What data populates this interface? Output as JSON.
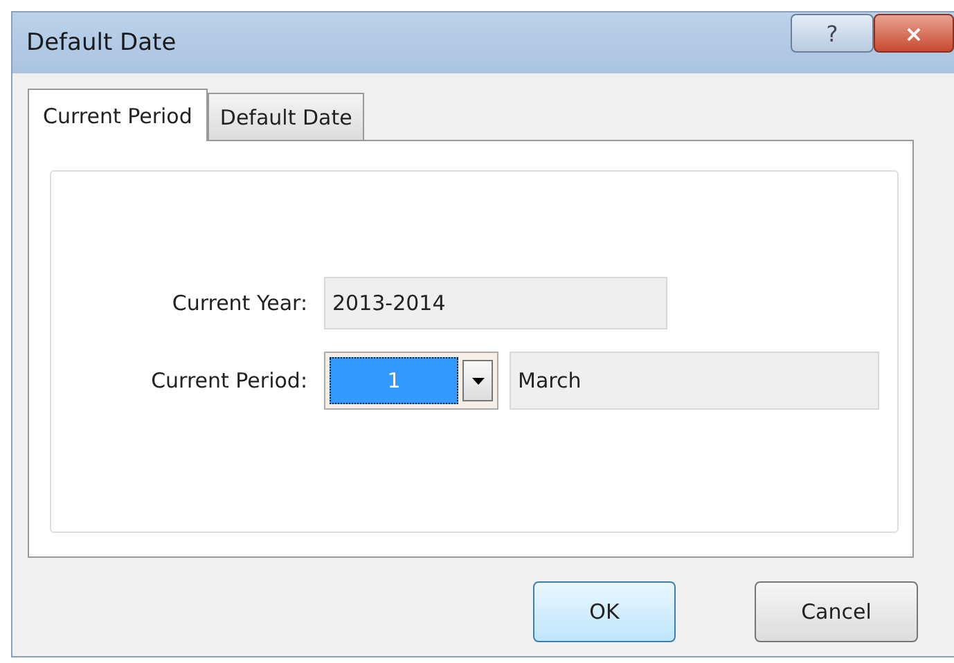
{
  "window": {
    "title": "Default Date",
    "buttons": [
      {
        "kind": "help",
        "label": "?"
      },
      {
        "kind": "close",
        "label": "×"
      }
    ]
  },
  "tabs": [
    {
      "label": "Current Period",
      "selected": true
    },
    {
      "label": "Default Date",
      "selected": false
    }
  ],
  "fields": [
    {
      "label": "Current Year:",
      "value": "2013-2014"
    },
    {
      "label": "Current Period:",
      "period": "1",
      "month": "March"
    }
  ],
  "buttons": [
    {
      "label": "OK",
      "default": true
    },
    {
      "label": "Cancel",
      "default": false
    }
  ]
}
